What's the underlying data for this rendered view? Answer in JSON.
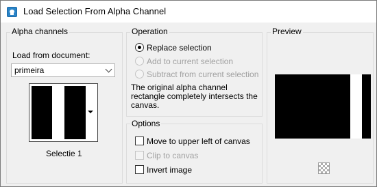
{
  "window": {
    "title": "Load Selection From Alpha Channel",
    "app_icon": "paint-shop-pro-icon"
  },
  "alpha_channels": {
    "group_label": "Alpha channels",
    "load_from_label": "Load from document:",
    "document_select_value": "primeira",
    "selected_channel_name": "Selectie 1"
  },
  "operation": {
    "group_label": "Operation",
    "options": [
      {
        "label": "Replace selection",
        "checked": true,
        "enabled": true
      },
      {
        "label": "Add to current selection",
        "checked": false,
        "enabled": false
      },
      {
        "label": "Subtract from current selection",
        "checked": false,
        "enabled": false
      }
    ],
    "info_text": "The original alpha channel rectangle completely intersects the canvas."
  },
  "options": {
    "group_label": "Options",
    "items": [
      {
        "label": "Move to upper left of canvas",
        "checked": false,
        "enabled": true
      },
      {
        "label": "Clip to canvas",
        "checked": false,
        "enabled": false
      },
      {
        "label": "Invert image",
        "checked": false,
        "enabled": true
      }
    ]
  },
  "preview": {
    "group_label": "Preview",
    "background_icon": "checkerboard-icon"
  },
  "colors": {
    "window_bg": "#f0f0f0",
    "group_border": "#dcdcdc",
    "disabled_text": "#a0a0a0",
    "selection_black": "#000000"
  }
}
